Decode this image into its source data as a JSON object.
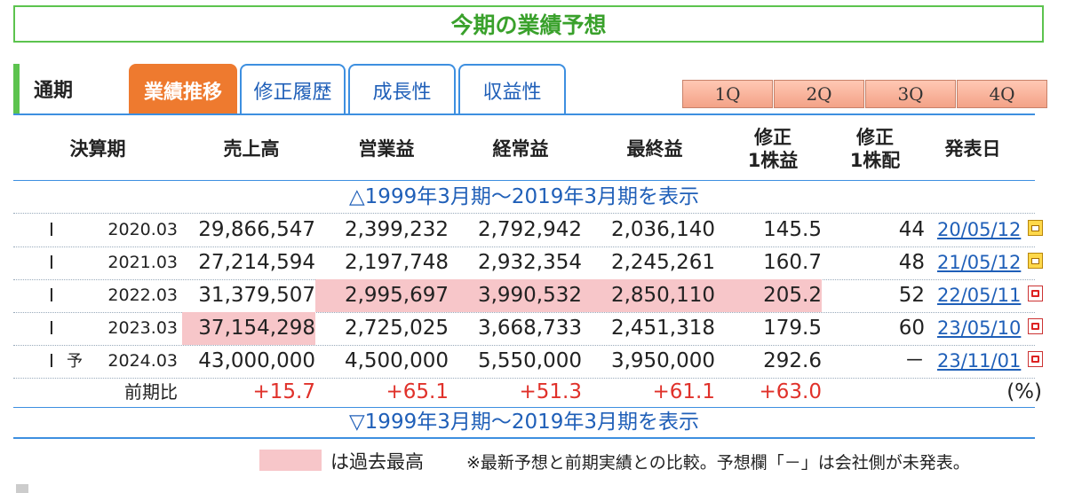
{
  "title": "今期の業績予想",
  "period_label": "通期",
  "tabs": [
    {
      "label": "業績推移",
      "active": true
    },
    {
      "label": "修正履歴",
      "active": false
    },
    {
      "label": "成長性",
      "active": false
    },
    {
      "label": "収益性",
      "active": false
    }
  ],
  "quarters": [
    "1Q",
    "2Q",
    "3Q",
    "4Q"
  ],
  "headers": {
    "period": "決算期",
    "sales": "売上高",
    "operating": "営業益",
    "ordinary": "経常益",
    "net": "最終益",
    "eps_line1": "修正",
    "eps_line2": "1株益",
    "dps_line1": "修正",
    "dps_line2": "1株配",
    "announce": "発表日"
  },
  "toggle_top": "△1999年3月期～2019年3月期を表示",
  "toggle_bottom": "▽1999年3月期～2019年3月期を表示",
  "rows": [
    {
      "mark": "I",
      "forecast": "",
      "period": "2020.03",
      "sales": "29,866,547",
      "operating": "2,399,232",
      "ordinary": "2,792,942",
      "net": "2,036,140",
      "eps": "145.5",
      "dps": "44",
      "date": "20/05/12",
      "icon": "calendar-icon"
    },
    {
      "mark": "I",
      "forecast": "",
      "period": "2021.03",
      "sales": "27,214,594",
      "operating": "2,197,748",
      "ordinary": "2,932,354",
      "net": "2,245,261",
      "eps": "160.7",
      "dps": "48",
      "date": "21/05/12",
      "icon": "calendar-icon"
    },
    {
      "mark": "I",
      "forecast": "",
      "period": "2022.03",
      "sales": "31,379,507",
      "operating": "2,995,697",
      "ordinary": "3,990,532",
      "net": "2,850,110",
      "eps": "205.2",
      "dps": "52",
      "date": "22/05/11",
      "icon": "pdf-icon"
    },
    {
      "mark": "I",
      "forecast": "",
      "period": "2023.03",
      "sales": "37,154,298",
      "operating": "2,725,025",
      "ordinary": "3,668,733",
      "net": "2,451,318",
      "eps": "179.5",
      "dps": "60",
      "date": "23/05/10",
      "icon": "pdf-icon"
    },
    {
      "mark": "I",
      "forecast": "予",
      "period": "2024.03",
      "sales": "43,000,000",
      "operating": "4,500,000",
      "ordinary": "5,550,000",
      "net": "3,950,000",
      "eps": "292.6",
      "dps": "－",
      "date": "23/11/01",
      "icon": "pdf-icon"
    }
  ],
  "yoy": {
    "label": "前期比",
    "sales": "+15.7",
    "operating": "+65.1",
    "ordinary": "+51.3",
    "net": "+61.1",
    "eps": "+63.0",
    "unit": "(%)"
  },
  "legend_text": "は過去最高",
  "note": "※最新予想と前期実績との比較。予想欄「－」は会社側が未発表。",
  "colors": {
    "highlight": "#f7c6c9",
    "accent_green": "#5cc34e",
    "tab_active": "#ee7a2f",
    "link": "#1f5fb8",
    "up": "#e0312a"
  }
}
